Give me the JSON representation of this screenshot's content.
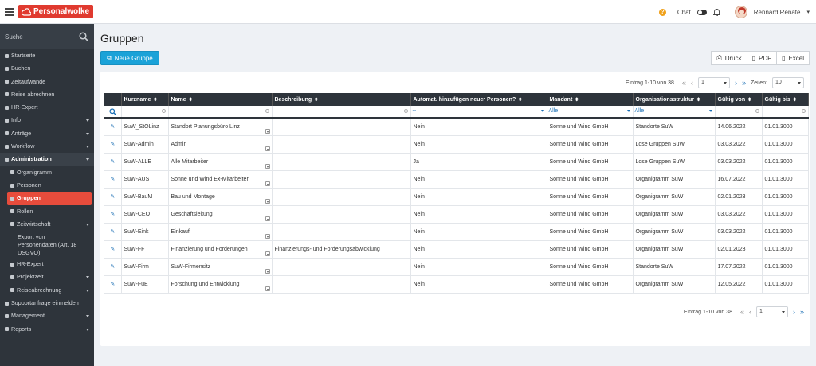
{
  "app": {
    "logo_text": "Personalwolke",
    "chat_label": "Chat",
    "user_name": "Rennard Renate"
  },
  "sidebar": {
    "search_placeholder": "Suche",
    "items": [
      {
        "label": "Startseite",
        "level": 0
      },
      {
        "label": "Buchen",
        "level": 0
      },
      {
        "label": "Zeitaufwände",
        "level": 0
      },
      {
        "label": "Reise abrechnen",
        "level": 0
      },
      {
        "label": "HR-Expert",
        "level": 0
      },
      {
        "label": "Info",
        "level": 0,
        "caret": true
      },
      {
        "label": "Anträge",
        "level": 0,
        "caret": true
      },
      {
        "label": "Workflow",
        "level": 0,
        "caret": true
      },
      {
        "label": "Administration",
        "level": 0,
        "caret": true,
        "header": true
      },
      {
        "label": "Organigramm",
        "level": 1
      },
      {
        "label": "Personen",
        "level": 1
      },
      {
        "label": "Gruppen",
        "level": 1,
        "active": true
      },
      {
        "label": "Rollen",
        "level": 1
      },
      {
        "label": "Zeitwirtschaft",
        "level": 1,
        "caret": true
      },
      {
        "label": "Export von Personendaten (Art. 18 DSGVO)",
        "level": 1,
        "multi": true
      },
      {
        "label": "HR-Expert",
        "level": 1
      },
      {
        "label": "Projektzeit",
        "level": 1,
        "caret": true
      },
      {
        "label": "Reiseabrechnung",
        "level": 1,
        "caret": true
      },
      {
        "label": "Supportanfrage einmelden",
        "level": 0
      },
      {
        "label": "Management",
        "level": 0,
        "caret": true
      },
      {
        "label": "Reports",
        "level": 0,
        "caret": true
      }
    ]
  },
  "page": {
    "title": "Gruppen",
    "new_button": "Neue Gruppe",
    "exports": [
      "Druck",
      "PDF",
      "Excel"
    ]
  },
  "pager": {
    "range_text": "Eintrag 1-10 von 38",
    "page": "1",
    "rows_label": "Zeilen:",
    "rows_value": "10"
  },
  "table": {
    "headers": [
      "Kurzname",
      "Name",
      "Beschreibung",
      "Automat. hinzufügen neuer Personen?",
      "Mandant",
      "Organisationsstruktur",
      "Gültig von",
      "Gültig bis"
    ],
    "filters": {
      "automat": "--",
      "mandant": "Alle",
      "org": "Alle"
    },
    "rows": [
      [
        "SuW_StOLinz",
        "Standort Planungsbüro Linz",
        "",
        "Nein",
        "Sonne und Wind GmbH",
        "Standorte SuW",
        "14.06.2022",
        "01.01.3000"
      ],
      [
        "SuW-Admin",
        "Admin",
        "",
        "Nein",
        "Sonne und Wind GmbH",
        "Lose Gruppen SuW",
        "03.03.2022",
        "01.01.3000"
      ],
      [
        "SuW-ALLE",
        "Alle Mitarbeiter",
        "",
        "Ja",
        "Sonne und Wind GmbH",
        "Lose Gruppen SuW",
        "03.03.2022",
        "01.01.3000"
      ],
      [
        "SuW-AUS",
        "Sonne und Wind Ex-Mitarbeiter",
        "",
        "Nein",
        "Sonne und Wind GmbH",
        "Organigramm SuW",
        "16.07.2022",
        "01.01.3000"
      ],
      [
        "SuW-BauM",
        "Bau und Montage",
        "",
        "Nein",
        "Sonne und Wind GmbH",
        "Organigramm SuW",
        "02.01.2023",
        "01.01.3000"
      ],
      [
        "SuW-CEO",
        "Geschäftsleitung",
        "",
        "Nein",
        "Sonne und Wind GmbH",
        "Organigramm SuW",
        "03.03.2022",
        "01.01.3000"
      ],
      [
        "SuW-Eink",
        "Einkauf",
        "",
        "Nein",
        "Sonne und Wind GmbH",
        "Organigramm SuW",
        "03.03.2022",
        "01.01.3000"
      ],
      [
        "SuW-FF",
        "Finanzierung und Förderungen",
        "Finanzierungs- und Förderungsabwicklung",
        "Nein",
        "Sonne und Wind GmbH",
        "Organigramm SuW",
        "02.01.2023",
        "01.01.3000"
      ],
      [
        "SuW-Firm",
        "SuW-Firmensitz",
        "",
        "Nein",
        "Sonne und Wind GmbH",
        "Standorte SuW",
        "17.07.2022",
        "01.01.3000"
      ],
      [
        "SuW-FuE",
        "Forschung und Entwicklung",
        "",
        "Nein",
        "Sonne und Wind GmbH",
        "Organigramm SuW",
        "12.05.2022",
        "01.01.3000"
      ]
    ]
  }
}
